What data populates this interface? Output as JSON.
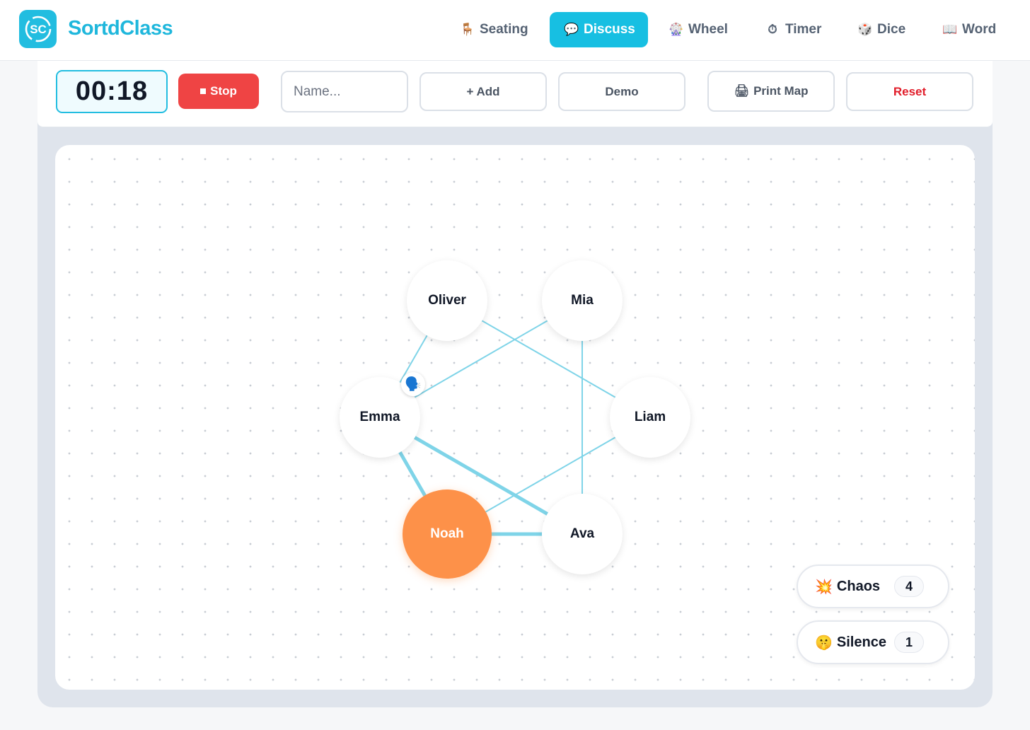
{
  "app": {
    "name": "SortdClass",
    "logo_mark": "SC",
    "accent": "#17bfe2"
  },
  "nav": [
    {
      "label": "Seating",
      "icon": "chair-icon",
      "glyph": "🪑",
      "active": false
    },
    {
      "label": "Discuss",
      "icon": "speech-bubble-icon",
      "glyph": "💬",
      "active": true
    },
    {
      "label": "Wheel",
      "icon": "ferris-wheel-icon",
      "glyph": "🎡",
      "active": false
    },
    {
      "label": "Timer",
      "icon": "stopwatch-icon",
      "glyph": "⏱",
      "active": false
    },
    {
      "label": "Dice",
      "icon": "dice-icon",
      "glyph": "🎲",
      "active": false
    },
    {
      "label": "Word",
      "icon": "book-icon",
      "glyph": "📖",
      "active": false
    }
  ],
  "toolbar": {
    "timer": "00:18",
    "stop_label": "Stop",
    "name_placeholder": "Name...",
    "add_label": "+ Add",
    "demo_label": "Demo",
    "print_label": "Print Map",
    "print_glyph": "🖨",
    "reset_label": "Reset",
    "stop_color": "#ef4444",
    "reset_color": "#e11d2a"
  },
  "discussion": {
    "active_speaker": "Noah",
    "active_color": "#fd9149",
    "speaker_badge_glyph": "🗣️",
    "edge_color": "#7fd4e8",
    "participants": [
      "Oliver",
      "Mia",
      "Emma",
      "Liam",
      "Noah",
      "Ava"
    ],
    "connections": [
      {
        "from": "Oliver",
        "to": "Emma",
        "weight": 1
      },
      {
        "from": "Oliver",
        "to": "Liam",
        "weight": 1
      },
      {
        "from": "Mia",
        "to": "Emma",
        "weight": 1
      },
      {
        "from": "Mia",
        "to": "Ava",
        "weight": 1
      },
      {
        "from": "Liam",
        "to": "Noah",
        "weight": 1
      },
      {
        "from": "Emma",
        "to": "Noah",
        "weight": 2
      },
      {
        "from": "Emma",
        "to": "Ava",
        "weight": 2
      },
      {
        "from": "Noah",
        "to": "Ava",
        "weight": 2
      }
    ]
  },
  "stats": {
    "chaos": {
      "label": "Chaos",
      "glyph": "💥",
      "count": "4"
    },
    "silence": {
      "label": "Silence",
      "glyph": "🤫",
      "count": "1"
    }
  }
}
